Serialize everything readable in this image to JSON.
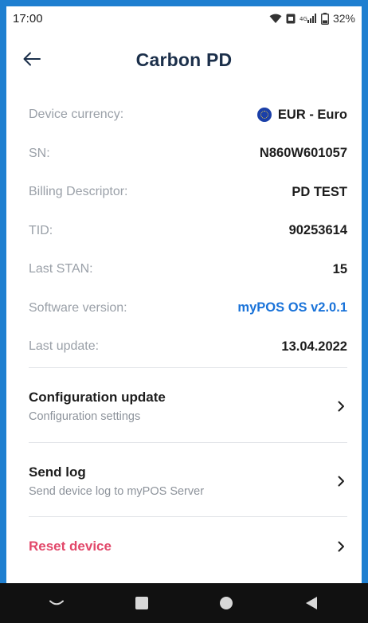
{
  "status_bar": {
    "time": "17:00",
    "battery": "32%",
    "icons": [
      "wifi-icon",
      "sim-icon",
      "signal-icon",
      "battery-icon"
    ]
  },
  "header": {
    "title": "Carbon PD",
    "back_icon": "arrow-left-icon"
  },
  "device_info": [
    {
      "label": "Device currency:",
      "value": "EUR - Euro",
      "icon": "eu-flag-icon"
    },
    {
      "label": "SN:",
      "value": "N860W601057"
    },
    {
      "label": "Billing Descriptor:",
      "value": "PD TEST"
    },
    {
      "label": "TID:",
      "value": "90253614"
    },
    {
      "label": "Last STAN:",
      "value": "15"
    },
    {
      "label": "Software version:",
      "value": "myPOS OS v2.0.1",
      "link": true
    },
    {
      "label": "Last update:",
      "value": "13.04.2022"
    }
  ],
  "actions": [
    {
      "title": "Configuration update",
      "subtitle": "Configuration settings"
    },
    {
      "title": "Send log",
      "subtitle": "Send device log to myPOS Server"
    },
    {
      "title": "Reset device"
    }
  ],
  "colors": {
    "frame": "#1f7fd0",
    "title": "#1b2f4a",
    "link": "#1a73d9",
    "danger": "#e2486a",
    "label": "#9aa0a8"
  },
  "nav_bar": [
    "nav-back-icon",
    "nav-home-icon",
    "nav-circle-icon",
    "nav-recent-icon"
  ]
}
